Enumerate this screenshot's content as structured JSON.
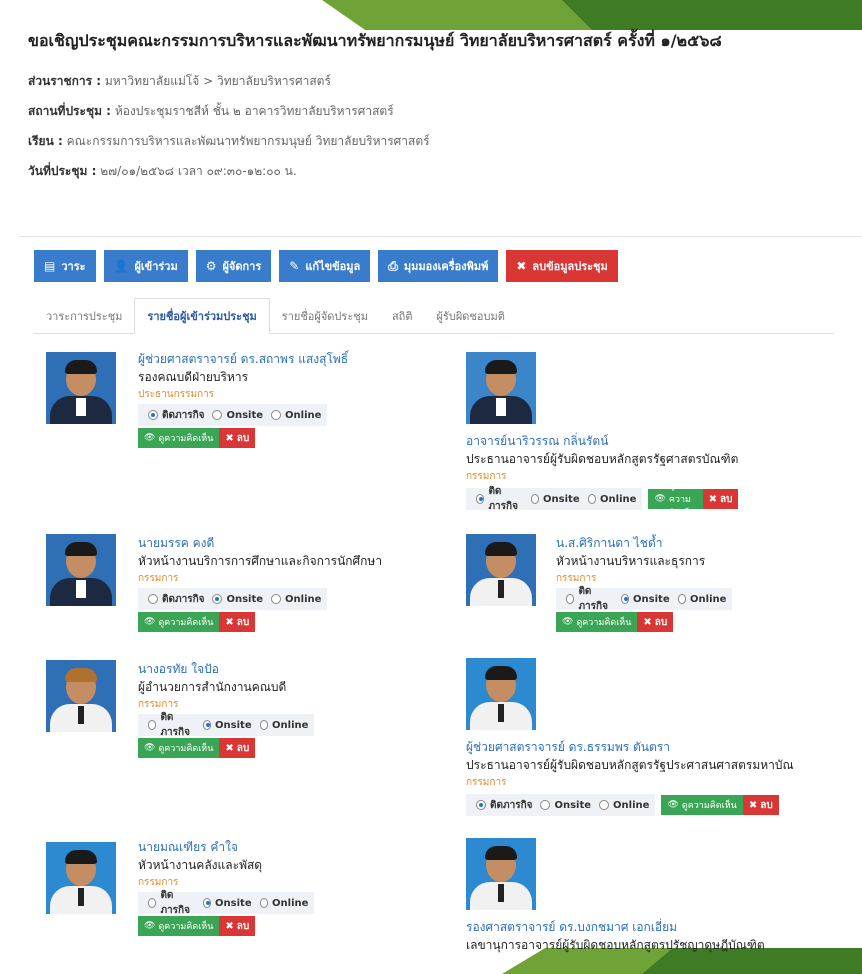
{
  "meeting": {
    "title": "ขอเชิญประชุมคณะกรรมการบริหารและพัฒนาทรัพยากรมนุษย์ วิทยาลัยบริหารศาสตร์ ครั้งที่ ๑/๒๕๖๘",
    "department_label": "ส่วนราชการ :",
    "department_value": "มหาวิทยาลัยแม่โจ้ > วิทยาลัยบริหารศาสตร์",
    "location_label": "สถานที่ประชุม :",
    "location_value": "ห้องประชุมราชสีห์ ชั้น ๒ อาคารวิทยาลัยบริหารศาสตร์",
    "to_label": "เรียน :",
    "to_value": "คณะกรรมการบริหารและพัฒนาทรัพยากรมนุษย์ วิทยาลัยบริหารศาสตร์",
    "date_label": "วันที่ประชุม :",
    "date_value": "๒๗/๐๑/๒๕๖๘ เวลา ๐๙:๓๐-๑๒:๐๐ น."
  },
  "toolbar": {
    "agenda": "วาระ",
    "participants": "ผู้เข้าร่วม",
    "organizers": "ผู้จัดการ",
    "edit": "แก้ไขข้อมูล",
    "print": "มุมมองเครื่องพิมพ์",
    "delete": "ลบข้อมูลประชุม"
  },
  "tabs": [
    "วาระการประชุม",
    "รายชื่อผู้เข้าร่วมประชุม",
    "รายชื่อผู้จัดประชุม",
    "สถิติ",
    "ผู้รับผิดชอบมติ"
  ],
  "attendance_options": [
    "ติดภารกิจ",
    "Onsite",
    "Online"
  ],
  "action_labels": {
    "view_comment": "ดูความคิดเห็น",
    "delete": "ลบ"
  },
  "people": [
    {
      "name": "ผู้ช่วยศาสตราจารย์ ดร.สถาพร แสงสุโพธิ์",
      "position": "รองคณบดีฝ่ายบริหาร",
      "role": "ประธานกรรมการ",
      "attendance": "ติดภารกิจ"
    },
    {
      "name": "อาจารย์นาริวรรณ กลิ่นรัตน์",
      "position": "ประธานอาจารย์ผู้รับผิดชอบหลักสูตรรัฐศาสตรบัณฑิต",
      "role": "กรรมการ",
      "attendance": "ติดภารกิจ"
    },
    {
      "name": "นายมรรค คงดี",
      "position": "หัวหน้างานบริการการศึกษาและกิจการนักศึกษา",
      "role": "กรรมการ",
      "attendance": "Onsite"
    },
    {
      "name": "น.ส.ศิริกานดา ไชด้ำ",
      "position": "หัวหน้างานบริหารและธุรการ",
      "role": "กรรมการ",
      "attendance": "Onsite"
    },
    {
      "name": "นางอรทัย ใจปัอ",
      "position": "ผู้อำนวยการสำนักงานคณบดี",
      "role": "กรรมการ",
      "attendance": "Onsite"
    },
    {
      "name": "ผู้ช่วยศาสตราจารย์ ดร.ธรรมพร ตันตรา",
      "position": "ประธานอาจารย์ผู้รับผิดชอบหลักสูตรรัฐประศาสนศาสตรมหาบัณ",
      "role": "กรรมการ",
      "attendance": "ติดภารกิจ"
    },
    {
      "name": "นายมณเฑียร คำใจ",
      "position": "หัวหน้างานคลังและพัสดุ",
      "role": "กรรมการ",
      "attendance": "Onsite"
    },
    {
      "name": "รองศาสตราจารย์ ดร.บงกชมาศ เอกเอี่ยม",
      "position": "เลขานุการอาจารย์ผู้รับผิดชอบหลักสูตรปรัชญาดุษฎีบัณฑิต",
      "role": "",
      "attendance": ""
    }
  ]
}
